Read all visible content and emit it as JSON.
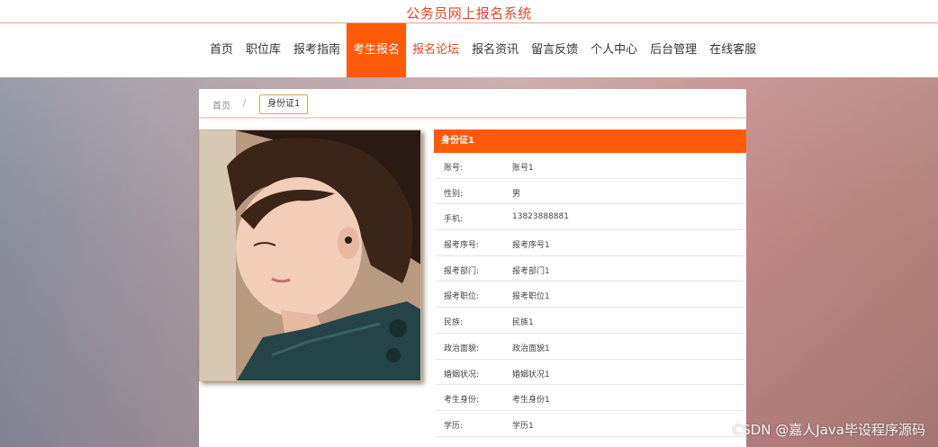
{
  "site": {
    "title": "公务员网上报名系统"
  },
  "nav": {
    "items": [
      "首页",
      "职位库",
      "报考指南",
      "考生报名",
      "报名论坛",
      "报名资讯",
      "留言反馈",
      "个人中心",
      "后台管理",
      "在线客服"
    ],
    "active_index": 3,
    "hover_index": 4
  },
  "breadcrumb": {
    "home": "首页",
    "separator": "/",
    "current": "身份证1"
  },
  "detail": {
    "title": "身份证1",
    "fields": [
      {
        "label": "账号:",
        "value": "账号1"
      },
      {
        "label": "性别:",
        "value": "男"
      },
      {
        "label": "手机:",
        "value": "13823888881"
      },
      {
        "label": "报考序号:",
        "value": "报考序号1"
      },
      {
        "label": "报考部门:",
        "value": "报考部门1"
      },
      {
        "label": "报考职位:",
        "value": "报考职位1"
      },
      {
        "label": "民族:",
        "value": "民族1"
      },
      {
        "label": "政治面貌:",
        "value": "政治面貌1"
      },
      {
        "label": "婚姻状况:",
        "value": "婚姻状况1"
      },
      {
        "label": "考生身份:",
        "value": "考生身份1"
      },
      {
        "label": "学历:",
        "value": "学历1"
      }
    ]
  },
  "watermark": "CSDN @嘉人Java毕设程序源码",
  "colors": {
    "accent": "#ff5a0a",
    "title": "#e0452a"
  }
}
